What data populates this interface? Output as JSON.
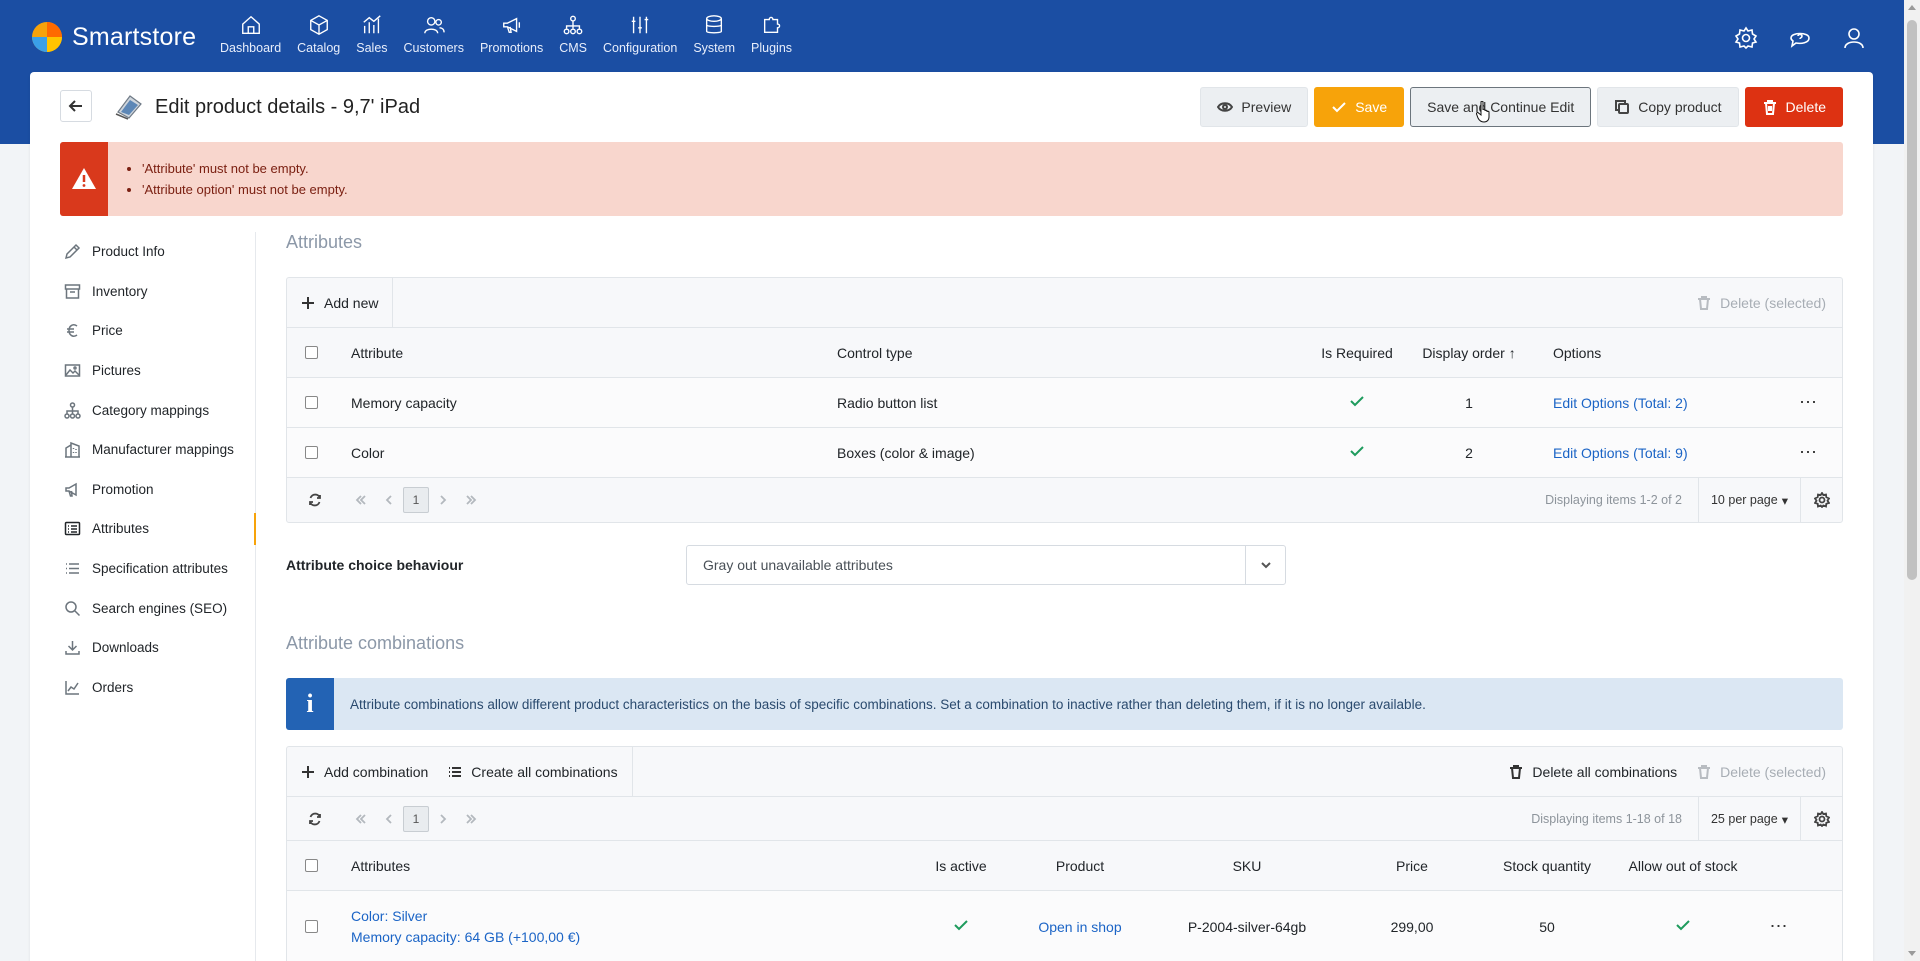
{
  "brand": {
    "name": "Smartstore"
  },
  "mainmenu": [
    {
      "label": "Dashboard",
      "icon": "home-icon"
    },
    {
      "label": "Catalog",
      "icon": "cube-icon"
    },
    {
      "label": "Sales",
      "icon": "chart-bar-icon"
    },
    {
      "label": "Customers",
      "icon": "users-icon"
    },
    {
      "label": "Promotions",
      "icon": "megaphone-icon"
    },
    {
      "label": "CMS",
      "icon": "sitemap-icon"
    },
    {
      "label": "Configuration",
      "icon": "sliders-icon"
    },
    {
      "label": "System",
      "icon": "database-icon"
    },
    {
      "label": "Plugins",
      "icon": "puzzle-icon"
    }
  ],
  "page": {
    "title": "Edit product details - 9,7' iPad",
    "actions": {
      "preview": "Preview",
      "save": "Save",
      "save_continue": "Save and Continue Edit",
      "copy": "Copy product",
      "delete": "Delete"
    }
  },
  "alert": {
    "errors": [
      "'Attribute' must not be empty.",
      "'Attribute option' must not be empty."
    ]
  },
  "sidebar": {
    "items": [
      {
        "label": "Product Info",
        "icon": "pencil-icon"
      },
      {
        "label": "Inventory",
        "icon": "archive-icon"
      },
      {
        "label": "Price",
        "icon": "euro-icon"
      },
      {
        "label": "Pictures",
        "icon": "image-icon"
      },
      {
        "label": "Category mappings",
        "icon": "hierarchy-icon"
      },
      {
        "label": "Manufacturer mappings",
        "icon": "building-icon"
      },
      {
        "label": "Promotion",
        "icon": "megaphone-icon"
      },
      {
        "label": "Attributes",
        "icon": "list-card-icon"
      },
      {
        "label": "Specification attributes",
        "icon": "list-icon"
      },
      {
        "label": "Search engines (SEO)",
        "icon": "search-icon"
      },
      {
        "label": "Downloads",
        "icon": "download-icon"
      },
      {
        "label": "Orders",
        "icon": "line-chart-icon"
      }
    ]
  },
  "attributes": {
    "title": "Attributes",
    "toolbar": {
      "add_new": "Add new",
      "delete_selected": "Delete (selected)"
    },
    "columns": {
      "attribute": "Attribute",
      "control_type": "Control type",
      "is_required": "Is Required",
      "display_order": "Display order",
      "options": "Options"
    },
    "rows": [
      {
        "attribute": "Memory capacity",
        "control_type": "Radio button list",
        "display_order": "1",
        "options": "Edit Options (Total: 2)"
      },
      {
        "attribute": "Color",
        "control_type": "Boxes (color & image)",
        "display_order": "2",
        "options": "Edit Options (Total: 9)"
      }
    ],
    "pager": {
      "page": "1",
      "info": "Displaying items 1-2 of 2",
      "per_page": "10 per page"
    }
  },
  "choice_behaviour": {
    "label": "Attribute choice behaviour",
    "value": "Gray out unavailable attributes"
  },
  "combinations": {
    "title": "Attribute combinations",
    "info": "Attribute combinations allow different product characteristics on the basis of specific combinations. Set a combination to inactive rather than deleting them, if it is no longer available.",
    "toolbar": {
      "add": "Add combination",
      "create_all": "Create all combinations",
      "delete_all": "Delete all combinations",
      "delete_selected": "Delete (selected)"
    },
    "pager": {
      "page": "1",
      "info": "Displaying items 1-18 of 18",
      "per_page": "25 per page"
    },
    "columns": {
      "attributes": "Attributes",
      "is_active": "Is active",
      "product": "Product",
      "sku": "SKU",
      "price": "Price",
      "stock": "Stock quantity",
      "allow_oos": "Allow out of stock"
    },
    "rows": [
      {
        "attr_line1": "Color: Silver",
        "attr_line2": "Memory capacity: 64 GB (+100,00 €)",
        "product": "Open in shop",
        "sku": "P-2004-silver-64gb",
        "price": "299,00",
        "stock": "50"
      }
    ]
  },
  "colors": {
    "nav": "#1b4ea3",
    "accent": "#f7a30a",
    "danger": "#dd3212",
    "link": "#1b64c6",
    "success": "#1e9b5d"
  }
}
